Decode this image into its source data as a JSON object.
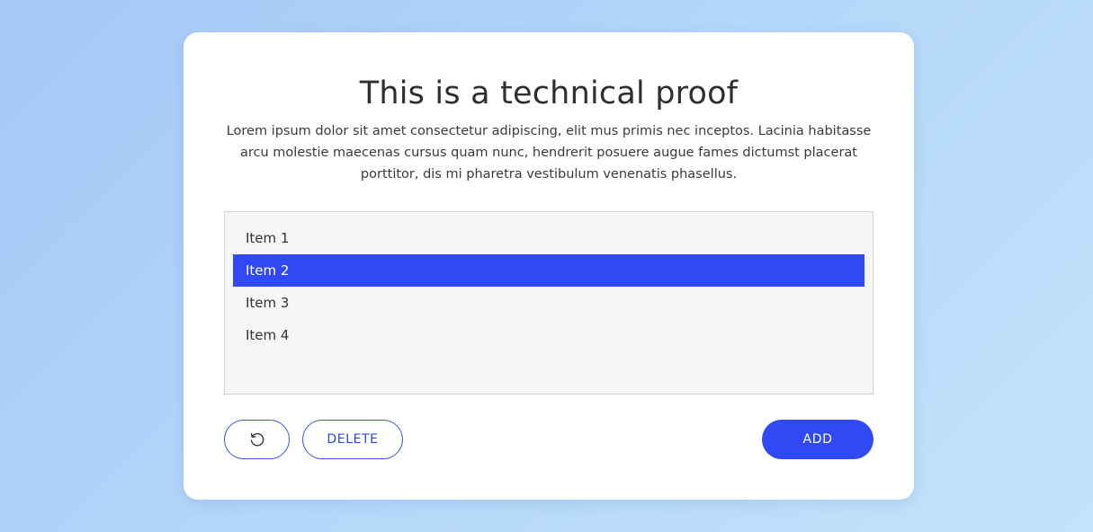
{
  "card": {
    "title": "This is a technical proof",
    "description": "Lorem ipsum dolor sit amet consectetur adipiscing, elit mus primis nec inceptos. Lacinia habitasse arcu molestie maecenas cursus quam nunc, hendrerit posuere augue fames dictumst placerat porttitor, dis mi pharetra vestibulum venenatis phasellus."
  },
  "list": {
    "items": [
      "Item 1",
      "Item 2",
      "Item 3",
      "Item 4"
    ],
    "selected_index": 1
  },
  "buttons": {
    "reset_icon": "reset-icon",
    "delete_label": "DELETE",
    "add_label": "ADD"
  },
  "colors": {
    "accent": "#3049f5",
    "outline": "#3d52e0",
    "card_background": "#ffffff",
    "list_background": "#f5f5f5"
  }
}
